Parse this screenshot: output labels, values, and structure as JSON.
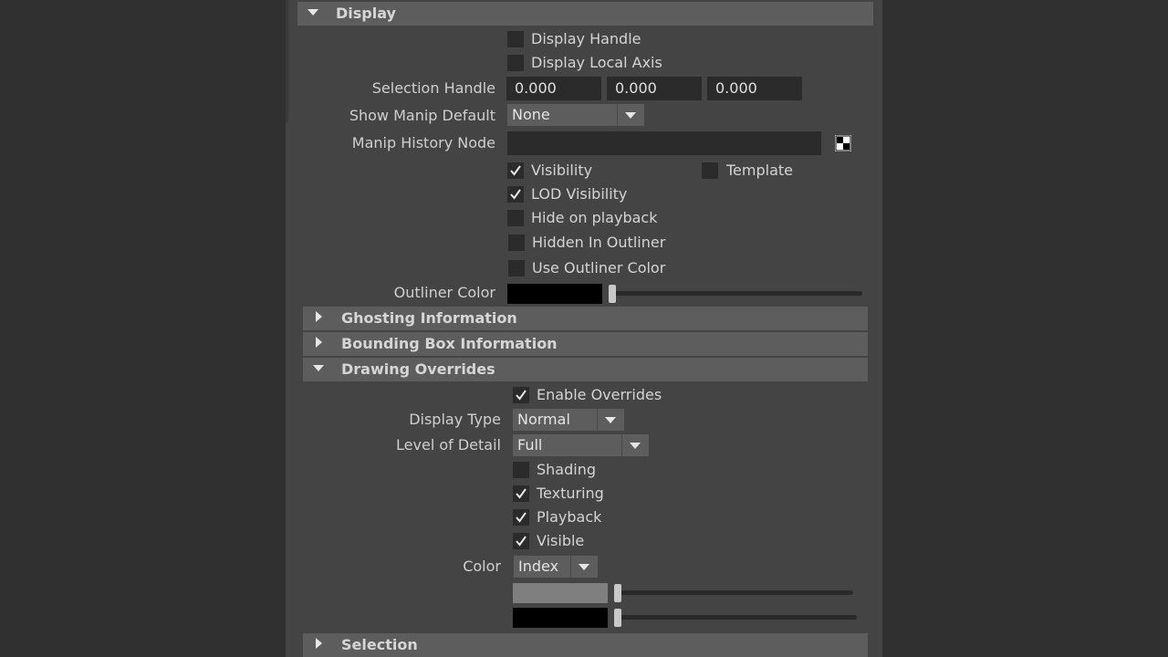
{
  "colors": {
    "background": "#303030",
    "panel": "#444444",
    "header": "#5d5d5d",
    "field": "#2b2b2b",
    "outliner_swatch": "#000000",
    "override_swatch_1": "#7f7f7f",
    "override_swatch_2": "#000000"
  },
  "display": {
    "header": "Display",
    "expanded": true,
    "display_handle": {
      "label": "Display Handle",
      "checked": false
    },
    "display_local_axis": {
      "label": "Display Local Axis",
      "checked": false
    },
    "selection_handle": {
      "label": "Selection Handle",
      "x": "0.000",
      "y": "0.000",
      "z": "0.000"
    },
    "show_manip_default": {
      "label": "Show Manip Default",
      "value": "None"
    },
    "manip_history_node": {
      "label": "Manip History Node",
      "value": ""
    },
    "visibility": {
      "label": "Visibility",
      "checked": true
    },
    "template": {
      "label": "Template",
      "checked": false
    },
    "lod_visibility": {
      "label": "LOD Visibility",
      "checked": true
    },
    "hide_on_playback": {
      "label": "Hide on playback",
      "checked": false
    },
    "hidden_in_outliner": {
      "label": "Hidden In Outliner",
      "checked": false
    },
    "use_outliner_color": {
      "label": "Use Outliner Color",
      "checked": false
    },
    "outliner_color": {
      "label": "Outliner Color",
      "slider_value": 0.0
    }
  },
  "ghosting": {
    "header": "Ghosting Information",
    "expanded": false
  },
  "bounding_box": {
    "header": "Bounding Box Information",
    "expanded": false
  },
  "drawing_overrides": {
    "header": "Drawing Overrides",
    "expanded": true,
    "enable_overrides": {
      "label": "Enable Overrides",
      "checked": true
    },
    "display_type": {
      "label": "Display Type",
      "value": "Normal"
    },
    "level_of_detail": {
      "label": "Level of Detail",
      "value": "Full"
    },
    "shading": {
      "label": "Shading",
      "checked": false
    },
    "texturing": {
      "label": "Texturing",
      "checked": true
    },
    "playback": {
      "label": "Playback",
      "checked": true
    },
    "visible": {
      "label": "Visible",
      "checked": true
    },
    "color": {
      "label": "Color",
      "value": "Index"
    },
    "color_slider_1_value": 0.0,
    "color_slider_2_value": 0.0
  },
  "selection": {
    "header": "Selection",
    "expanded": false
  }
}
